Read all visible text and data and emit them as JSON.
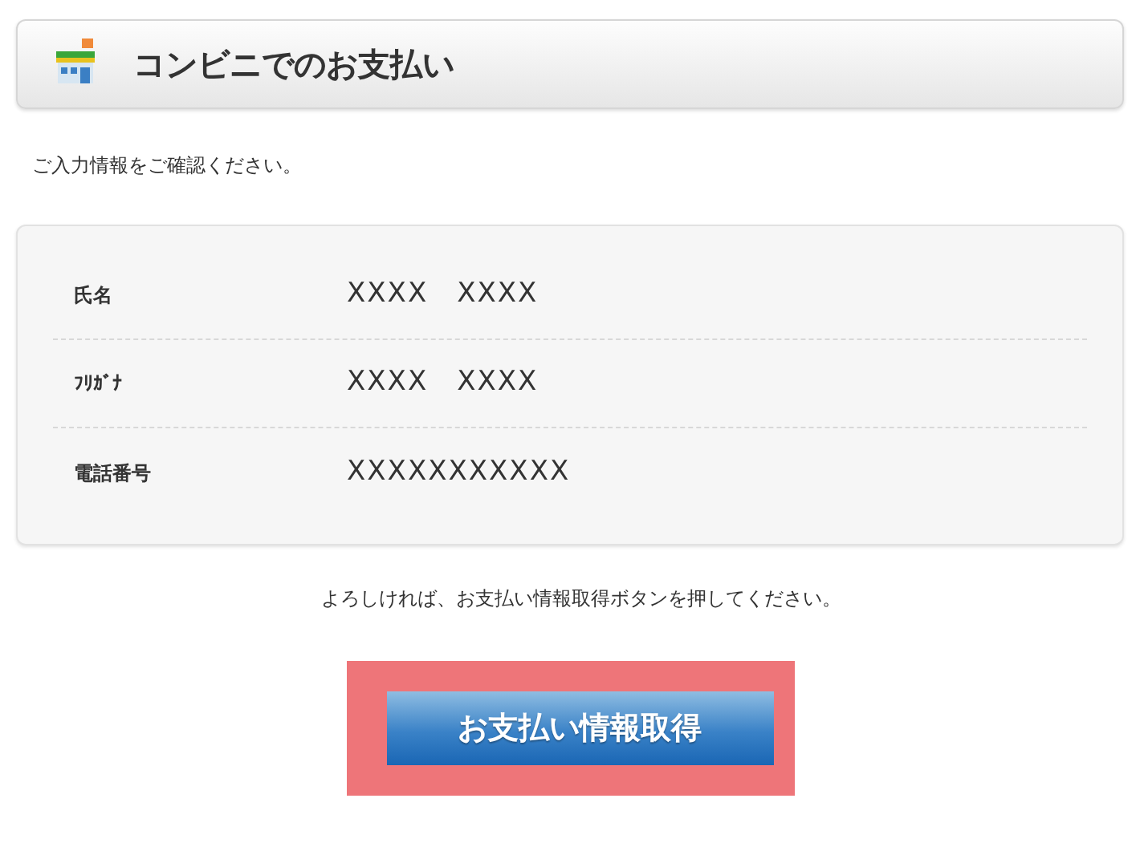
{
  "header": {
    "title": "コンビニでのお支払い"
  },
  "instruction": "ご入力情報をご確認ください。",
  "fields": [
    {
      "label": "氏名",
      "value": "XXXX　XXXX"
    },
    {
      "label": "ﾌﾘｶﾞﾅ",
      "value": "XXXX　XXXX"
    },
    {
      "label": "電話番号",
      "value": "XXXXXXXXXXX"
    }
  ],
  "note": "よろしければ、お支払い情報取得ボタンを押してください。",
  "button": {
    "label": "お支払い情報取得",
    "highlighted": true
  }
}
